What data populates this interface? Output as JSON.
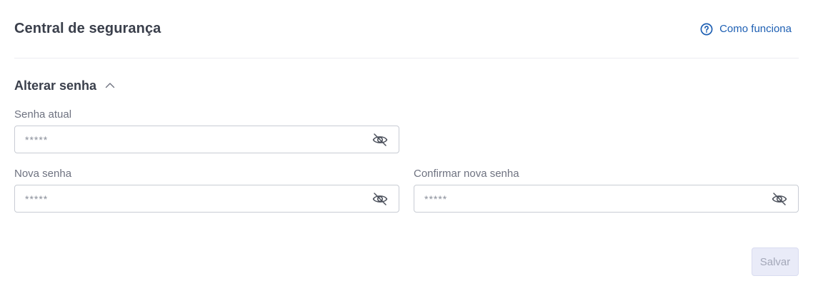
{
  "header": {
    "title": "Central de segurança",
    "help_link_label": "Como funciona",
    "help_icon": "question-circle-icon"
  },
  "section": {
    "title": "Alterar senha",
    "toggle_icon": "chevron-up-icon",
    "expanded": true
  },
  "fields": {
    "current_password": {
      "label": "Senha atual",
      "placeholder": "*****",
      "visibility_icon": "eye-off-icon"
    },
    "new_password": {
      "label": "Nova senha",
      "placeholder": "*****",
      "visibility_icon": "eye-off-icon"
    },
    "confirm_password": {
      "label": "Confirmar nova senha",
      "placeholder": "*****",
      "visibility_icon": "eye-off-icon"
    }
  },
  "actions": {
    "save_label": "Salvar",
    "save_disabled": true
  },
  "colors": {
    "link": "#1d5fb3",
    "text": "#3a3f4b",
    "label": "#6e7280",
    "border": "#c8ccd4",
    "button_disabled_bg": "#e9ebf8",
    "button_disabled_text": "#a3a7b8"
  }
}
